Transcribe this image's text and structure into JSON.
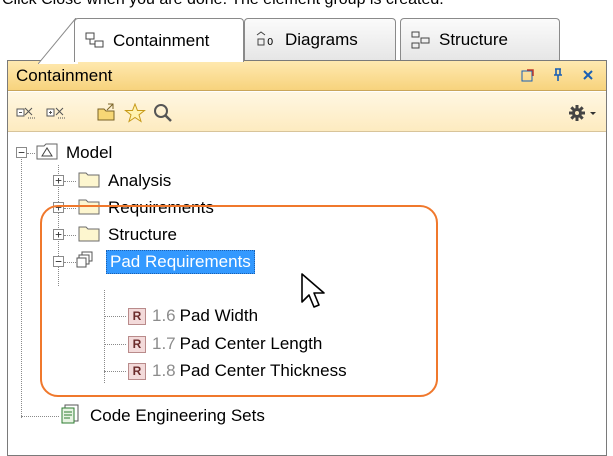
{
  "caption": "Click Close when you are done. The element group is created.",
  "tabs": [
    {
      "label": "Containment",
      "icon": "containment-tab-icon",
      "active": true
    },
    {
      "label": "Diagrams",
      "icon": "diagrams-tab-icon",
      "active": false
    },
    {
      "label": "Structure",
      "icon": "structure-tab-icon",
      "active": false
    }
  ],
  "panel": {
    "title": "Containment",
    "header_buttons": [
      "float-icon",
      "pin-icon",
      "close-icon"
    ],
    "toolbar": [
      "collapse-all-icon",
      "expand-all-icon",
      "open-folder-icon",
      "star-icon",
      "search-icon",
      "gear-icon"
    ]
  },
  "tree": {
    "root": "Model",
    "packages": [
      "Analysis",
      "Requirements",
      "Structure"
    ],
    "group": "Pad Requirements",
    "requirements": [
      {
        "id": "1.6",
        "name": "Pad Width"
      },
      {
        "id": "1.7",
        "name": "Pad Center Length"
      },
      {
        "id": "1.8",
        "name": "Pad Center Thickness"
      }
    ],
    "code_sets": "Code Engineering Sets"
  },
  "colors": {
    "header": "#f7d37d",
    "toolbar": "#fdebc0",
    "selection": "#3399ff",
    "highlight": "#f0782c"
  }
}
